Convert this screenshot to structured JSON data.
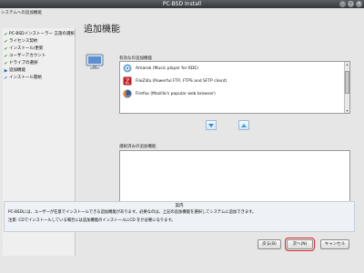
{
  "window": {
    "title": "PC-BSD Install"
  },
  "header": {
    "section": "システムへの追加機能"
  },
  "sidebar": {
    "items": [
      {
        "label": "PC-BSDインストーラー 言語の選択",
        "state": "done"
      },
      {
        "label": "ライセンス契約",
        "state": "done"
      },
      {
        "label": "インストール/更新",
        "state": "done"
      },
      {
        "label": "ユーザーアカウント",
        "state": "done"
      },
      {
        "label": "ドライブの選択",
        "state": "done"
      },
      {
        "label": "追加機能",
        "state": "current"
      },
      {
        "label": "インストール開始",
        "state": "todo"
      }
    ]
  },
  "main": {
    "title": "追加機能",
    "available_label": "有効なの追加機能",
    "available": [
      {
        "label": "Amarok (Music player for KDE)",
        "icon": "amarok-icon"
      },
      {
        "label": "FileZilla (Powerful FTP, FTPS and SFTP client)",
        "icon": "filezilla-icon"
      },
      {
        "label": "Firefox (Mozilla's popular web browser)",
        "icon": "firefox-icon"
      }
    ],
    "selected_label": "選択済みの追加機能"
  },
  "help": {
    "title": "案内",
    "line1": "PC-BSDには、ユーザーが任意でインストールできる追加機能があります。必要なのは、上記の追加機能を選択してシステムに追加できます。",
    "line2": "注意: CDでインストールしている場合には追加機能のインストールにCD をが必要になります。"
  },
  "buttons": {
    "back": "戻る(B)",
    "next": "次へ(N)",
    "cancel": "キャンセル"
  },
  "colors": {
    "titlebar": "#3c4046",
    "check": "#2e9a2e",
    "next_highlight": "#e0262c"
  }
}
